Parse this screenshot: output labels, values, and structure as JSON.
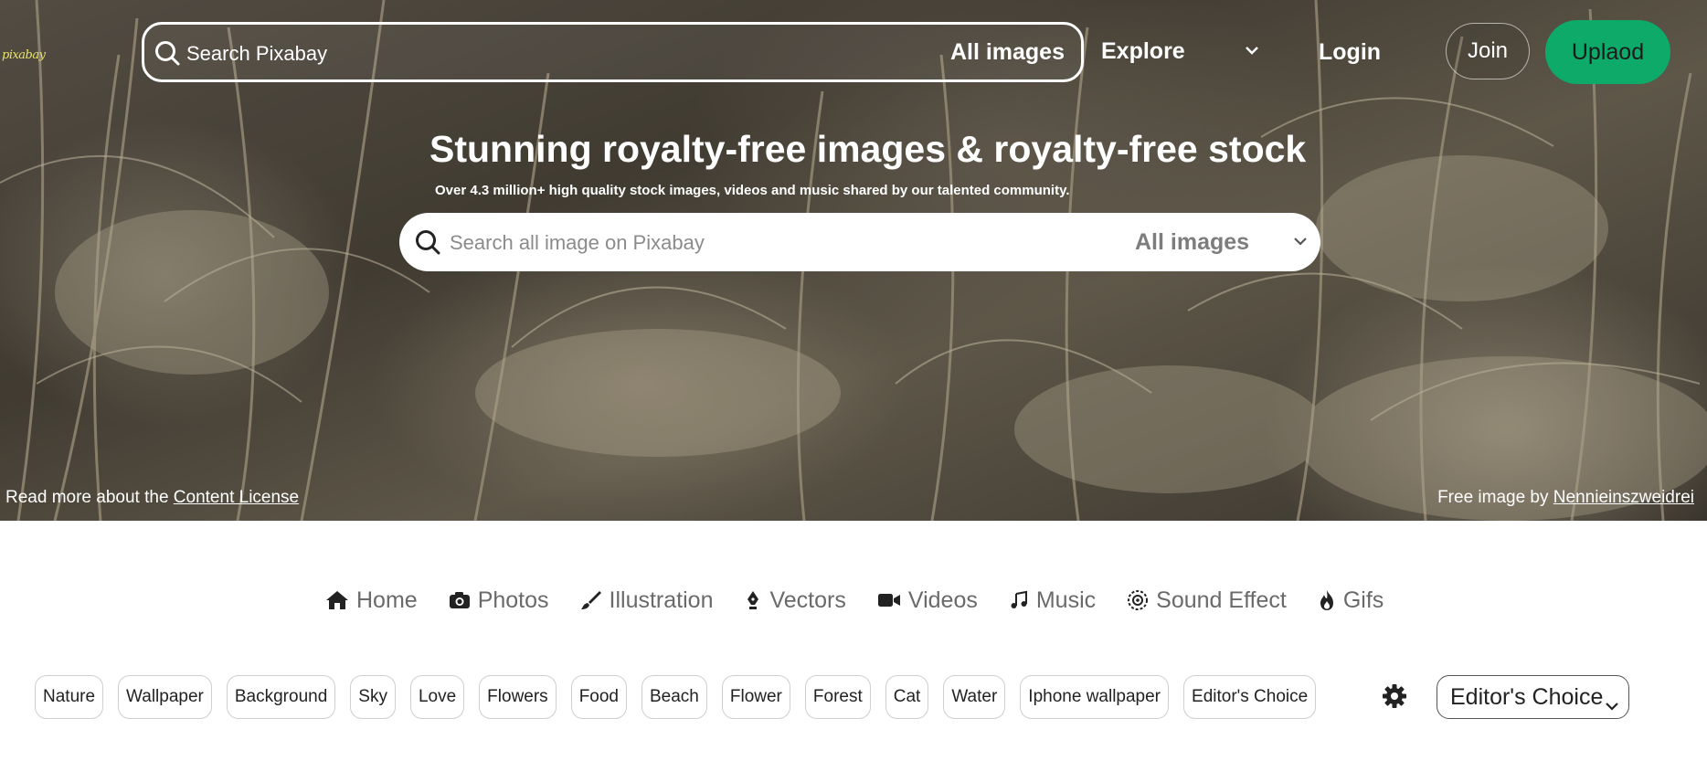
{
  "header": {
    "logo_text": "pixabay",
    "search_placeholder": "Search Pixabay",
    "search_scope": "All images",
    "explore_label": "Explore",
    "login_label": "Login",
    "join_label": "Join",
    "upload_label": "Uplaod"
  },
  "hero": {
    "title": "Stunning royalty-free images & royalty-free stock",
    "subtitle": "Over 4.3 million+ high quality stock images, videos and music shared by our talented community.",
    "search_placeholder": "Search all image on Pixabay",
    "search_scope": "All images",
    "license_prefix": "Read more about the ",
    "license_link": "Content License",
    "credit_prefix": "Free image by ",
    "credit_author": "Nennieinszweidrei"
  },
  "media_tabs": [
    {
      "label": "Home",
      "icon": "home-icon"
    },
    {
      "label": "Photos",
      "icon": "camera-icon"
    },
    {
      "label": "Illustration",
      "icon": "brush-icon"
    },
    {
      "label": "Vectors",
      "icon": "pen-nib-icon"
    },
    {
      "label": "Videos",
      "icon": "video-camera-icon"
    },
    {
      "label": "Music",
      "icon": "music-icon"
    },
    {
      "label": "Sound Effect",
      "icon": "sound-effect-icon"
    },
    {
      "label": "Gifs",
      "icon": "flame-icon"
    }
  ],
  "tags": [
    "Nature",
    "Wallpaper",
    "Background",
    "Sky",
    "Love",
    "Flowers",
    "Food",
    "Beach",
    "Flower",
    "Forest",
    "Cat",
    "Water",
    "Iphone wallpaper",
    "Editor's Choice"
  ],
  "sort": {
    "selected": "Editor's Choice"
  },
  "colors": {
    "accent": "#0daa6a",
    "logo": "#e9e26a"
  }
}
